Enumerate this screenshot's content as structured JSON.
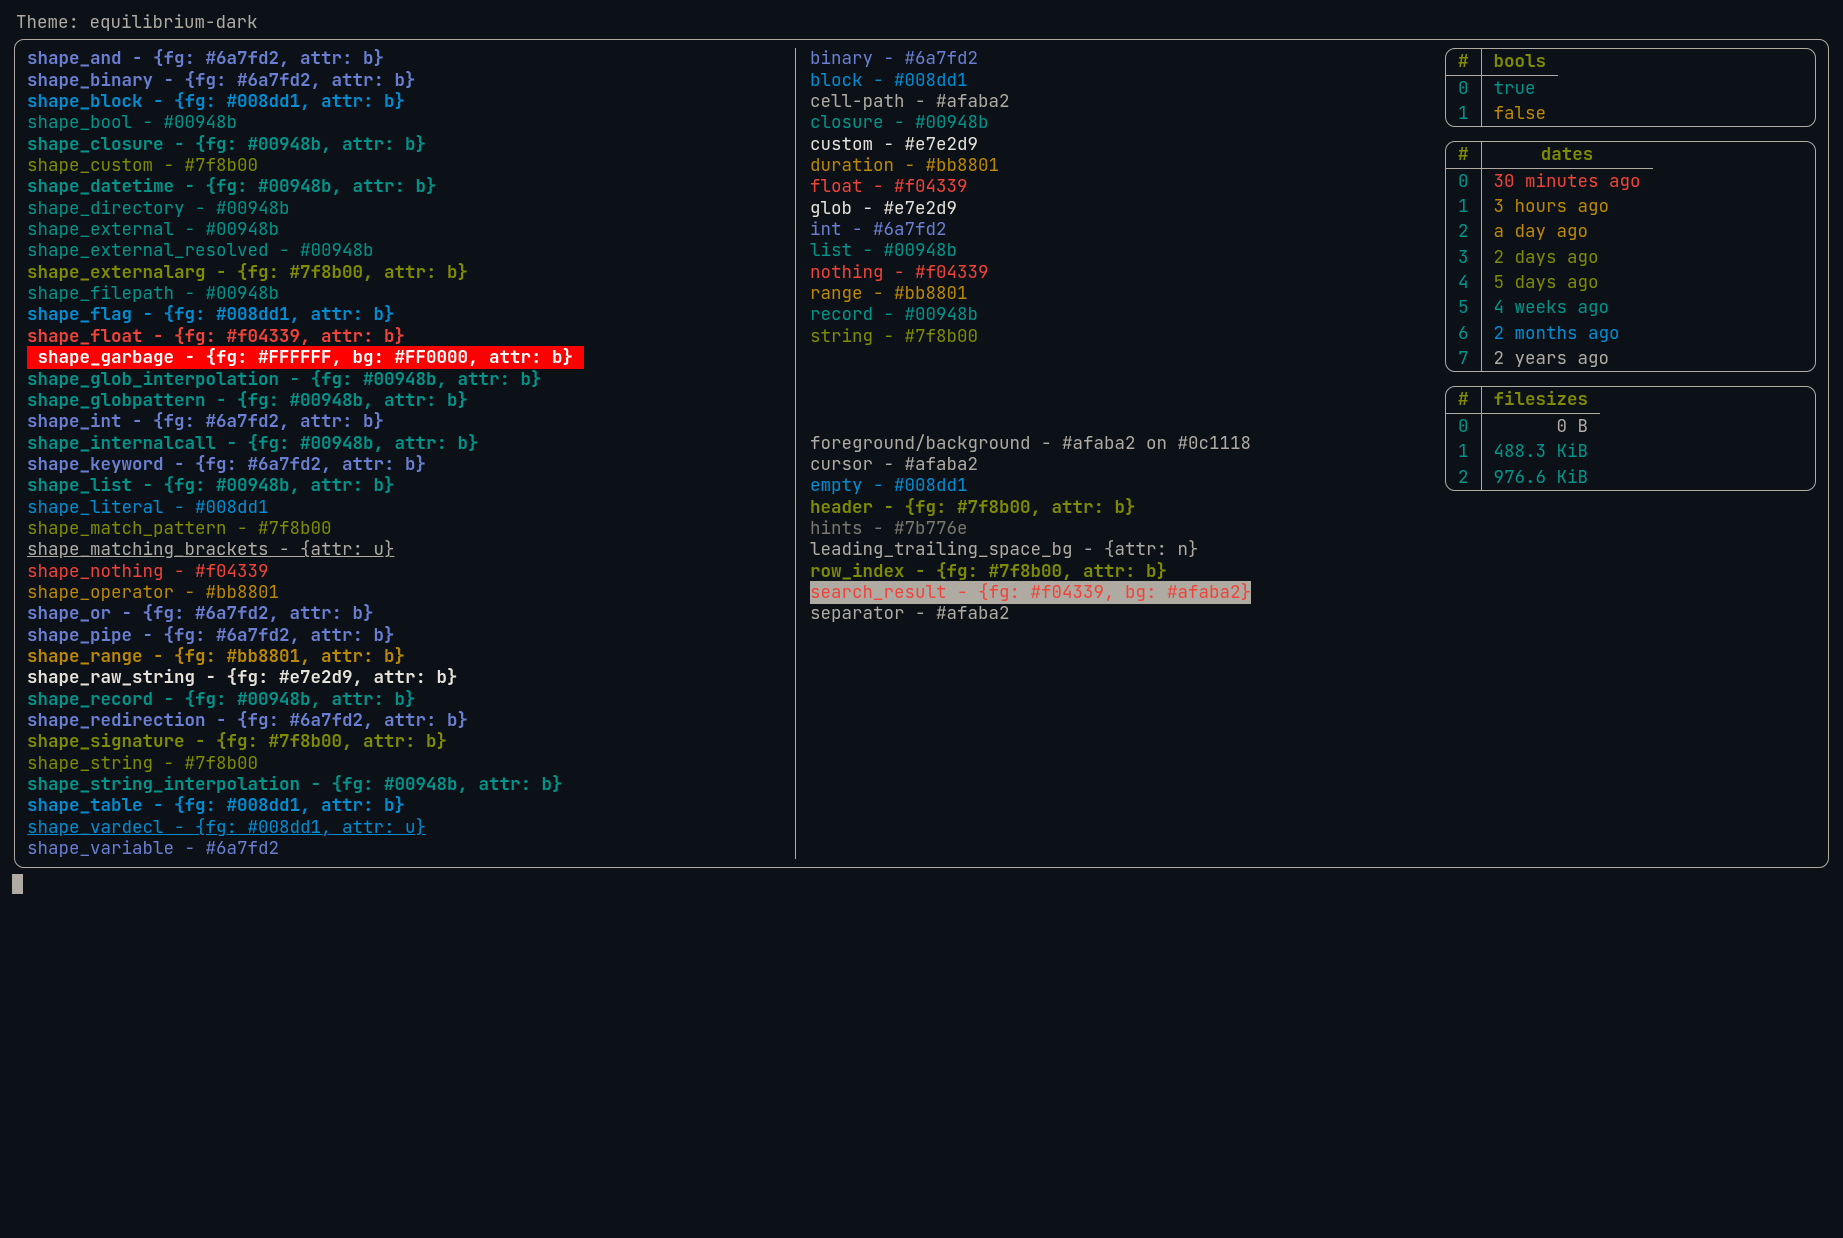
{
  "title_label": "Theme:",
  "theme_name": "equilibrium-dark",
  "shapes": [
    {
      "k": "shape_and",
      "style": "{fg: #6a7fd2, attr: b}",
      "color": "blue",
      "bold": true
    },
    {
      "k": "shape_binary",
      "style": "{fg: #6a7fd2, attr: b}",
      "color": "blue",
      "bold": true
    },
    {
      "k": "shape_block",
      "style": "{fg: #008dd1, attr: b}",
      "color": "cyan",
      "bold": true
    },
    {
      "k": "shape_bool",
      "style": "#00948b",
      "color": "teal"
    },
    {
      "k": "shape_closure",
      "style": "{fg: #00948b, attr: b}",
      "color": "teal",
      "bold": true
    },
    {
      "k": "shape_custom",
      "style": "#7f8b00",
      "color": "olive"
    },
    {
      "k": "shape_datetime",
      "style": "{fg: #00948b, attr: b}",
      "color": "teal",
      "bold": true
    },
    {
      "k": "shape_directory",
      "style": "#00948b",
      "color": "teal"
    },
    {
      "k": "shape_external",
      "style": "#00948b",
      "color": "teal"
    },
    {
      "k": "shape_external_resolved",
      "style": "#00948b",
      "color": "teal"
    },
    {
      "k": "shape_externalarg",
      "style": "{fg: #7f8b00, attr: b}",
      "color": "olive",
      "bold": true
    },
    {
      "k": "shape_filepath",
      "style": "#00948b",
      "color": "teal"
    },
    {
      "k": "shape_flag",
      "style": "{fg: #008dd1, attr: b}",
      "color": "cyan",
      "bold": true
    },
    {
      "k": "shape_float",
      "style": "{fg: #f04339, attr: b}",
      "color": "red",
      "bold": true
    },
    {
      "k": "shape_garbage",
      "style": "{fg: #FFFFFF, bg: #FF0000, attr: b}",
      "color": "garbage",
      "bold": true
    },
    {
      "k": "shape_glob_interpolation",
      "style": "{fg: #00948b, attr: b}",
      "color": "teal",
      "bold": true
    },
    {
      "k": "shape_globpattern",
      "style": "{fg: #00948b, attr: b}",
      "color": "teal",
      "bold": true
    },
    {
      "k": "shape_int",
      "style": "{fg: #6a7fd2, attr: b}",
      "color": "blue",
      "bold": true
    },
    {
      "k": "shape_internalcall",
      "style": "{fg: #00948b, attr: b}",
      "color": "teal",
      "bold": true
    },
    {
      "k": "shape_keyword",
      "style": "{fg: #6a7fd2, attr: b}",
      "color": "blue",
      "bold": true
    },
    {
      "k": "shape_list",
      "style": "{fg: #00948b, attr: b}",
      "color": "teal",
      "bold": true
    },
    {
      "k": "shape_literal",
      "style": "#008dd1",
      "color": "cyan"
    },
    {
      "k": "shape_match_pattern",
      "style": "#7f8b00",
      "color": "olive"
    },
    {
      "k": "shape_matching_brackets",
      "style": "{attr: u}",
      "color": "fg",
      "underline": true
    },
    {
      "k": "shape_nothing",
      "style": "#f04339",
      "color": "red"
    },
    {
      "k": "shape_operator",
      "style": "#bb8801",
      "color": "orange"
    },
    {
      "k": "shape_or",
      "style": "{fg: #6a7fd2, attr: b}",
      "color": "blue",
      "bold": true
    },
    {
      "k": "shape_pipe",
      "style": "{fg: #6a7fd2, attr: b}",
      "color": "blue",
      "bold": true
    },
    {
      "k": "shape_range",
      "style": "{fg: #bb8801, attr: b}",
      "color": "orange",
      "bold": true
    },
    {
      "k": "shape_raw_string",
      "style": "{fg: #e7e2d9, attr: b}",
      "color": "white",
      "bold": true
    },
    {
      "k": "shape_record",
      "style": "{fg: #00948b, attr: b}",
      "color": "teal",
      "bold": true
    },
    {
      "k": "shape_redirection",
      "style": "{fg: #6a7fd2, attr: b}",
      "color": "blue",
      "bold": true
    },
    {
      "k": "shape_signature",
      "style": "{fg: #7f8b00, attr: b}",
      "color": "olive",
      "bold": true
    },
    {
      "k": "shape_string",
      "style": "#7f8b00",
      "color": "olive"
    },
    {
      "k": "shape_string_interpolation",
      "style": "{fg: #00948b, attr: b}",
      "color": "teal",
      "bold": true
    },
    {
      "k": "shape_table",
      "style": "{fg: #008dd1, attr: b}",
      "color": "cyan",
      "bold": true
    },
    {
      "k": "shape_vardecl",
      "style": "{fg: #008dd1, attr: u}",
      "color": "cyan",
      "underline": true
    },
    {
      "k": "shape_variable",
      "style": "#6a7fd2",
      "color": "blue"
    }
  ],
  "types": [
    {
      "k": "binary",
      "v": "#6a7fd2",
      "color": "blue"
    },
    {
      "k": "block",
      "v": "#008dd1",
      "color": "cyan"
    },
    {
      "k": "cell-path",
      "v": "#afaba2",
      "color": "fg"
    },
    {
      "k": "closure",
      "v": "#00948b",
      "color": "teal"
    },
    {
      "k": "custom",
      "v": "#e7e2d9",
      "color": "white"
    },
    {
      "k": "duration",
      "v": "#bb8801",
      "color": "orange"
    },
    {
      "k": "float",
      "v": "#f04339",
      "color": "red"
    },
    {
      "k": "glob",
      "v": "#e7e2d9",
      "color": "white"
    },
    {
      "k": "int",
      "v": "#6a7fd2",
      "color": "blue"
    },
    {
      "k": "list",
      "v": "#00948b",
      "color": "teal"
    },
    {
      "k": "nothing",
      "v": "#f04339",
      "color": "red"
    },
    {
      "k": "range",
      "v": "#bb8801",
      "color": "orange"
    },
    {
      "k": "record",
      "v": "#00948b",
      "color": "teal"
    },
    {
      "k": "string",
      "v": "#7f8b00",
      "color": "olive"
    }
  ],
  "misc": [
    {
      "k": "foreground/background",
      "v": "#afaba2 on #0c1118",
      "color": "fg"
    },
    {
      "k": "cursor",
      "v": "#afaba2",
      "color": "fg"
    },
    {
      "k": "empty",
      "v": "#008dd1",
      "color": "cyan"
    },
    {
      "k": "header",
      "v": "{fg: #7f8b00, attr: b}",
      "color": "olive",
      "bold": true
    },
    {
      "k": "hints",
      "v": "#7b776e",
      "color": "hints"
    },
    {
      "k": "leading_trailing_space_bg",
      "v": "{attr: n}",
      "color": "fg"
    },
    {
      "k": "row_index",
      "v": "{fg: #7f8b00, attr: b}",
      "color": "olive",
      "bold": true
    },
    {
      "k": "search_result",
      "v": "{fg: #f04339, bg: #afaba2}",
      "color": "search"
    },
    {
      "k": "separator",
      "v": "#afaba2",
      "color": "fg"
    }
  ],
  "bools": {
    "header_idx": "#",
    "header_val": "bools",
    "rows": [
      {
        "i": "0",
        "v": "true",
        "color": "teal"
      },
      {
        "i": "1",
        "v": "false",
        "color": "orange"
      }
    ]
  },
  "dates": {
    "header_idx": "#",
    "header_val": "dates",
    "rows": [
      {
        "i": "0",
        "v": "30 minutes ago",
        "color": "red",
        "bold": true
      },
      {
        "i": "1",
        "v": "3 hours ago",
        "color": "orange"
      },
      {
        "i": "2",
        "v": "a day ago",
        "color": "orange"
      },
      {
        "i": "3",
        "v": "2 days ago",
        "color": "olive"
      },
      {
        "i": "4",
        "v": "5 days ago",
        "color": "olive",
        "bold": true
      },
      {
        "i": "5",
        "v": "4 weeks ago",
        "color": "teal"
      },
      {
        "i": "6",
        "v": "2 months ago",
        "color": "cyan"
      },
      {
        "i": "7",
        "v": "2 years ago",
        "color": "fg"
      }
    ]
  },
  "filesizes": {
    "header_idx": "#",
    "header_val": "filesizes",
    "rows": [
      {
        "i": "0",
        "v": "0 B",
        "color": "fg"
      },
      {
        "i": "1",
        "v": "488.3 KiB",
        "color": "teal"
      },
      {
        "i": "2",
        "v": "976.6 KiB",
        "color": "teal"
      }
    ]
  }
}
